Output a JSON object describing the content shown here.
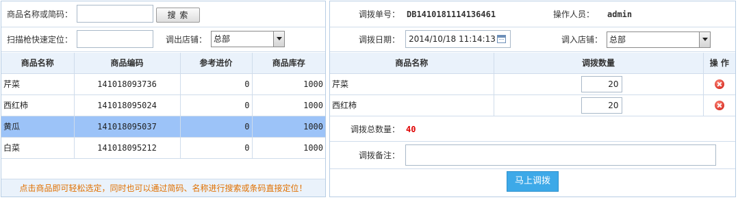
{
  "left": {
    "search_label": "商品名称或简码：",
    "search_value": "",
    "search_button": "搜 索",
    "scan_label": "扫描枪快速定位：",
    "scan_value": "",
    "out_store_label": "调出店铺：",
    "out_store_selected": "总部",
    "columns": [
      "商品名称",
      "商品编码",
      "参考进价",
      "商品库存"
    ],
    "rows": [
      {
        "name": "芹菜",
        "code": "141018093736",
        "price": "0",
        "stock": "1000",
        "selected": false
      },
      {
        "name": "西红柿",
        "code": "141018095024",
        "price": "0",
        "stock": "1000",
        "selected": false
      },
      {
        "name": "黄瓜",
        "code": "141018095037",
        "price": "0",
        "stock": "1000",
        "selected": true
      },
      {
        "name": "白菜",
        "code": "141018095212",
        "price": "0",
        "stock": "1000",
        "selected": false
      }
    ],
    "hint": "点击商品即可轻松选定，同时也可以通过简码、名称进行搜索或条码直接定位！"
  },
  "right": {
    "order_no_label": "调拨单号：",
    "order_no": "DB1410181114136461",
    "operator_label": "操作人员：",
    "operator": "admin",
    "date_label": "调拨日期：",
    "date_value": "2014/10/18 11:14:13",
    "in_store_label": "调入店铺：",
    "in_store_selected": "总部",
    "columns": [
      "商品名称",
      "调拨数量",
      "操 作"
    ],
    "items": [
      {
        "name": "芹菜",
        "qty": "20"
      },
      {
        "name": "西红柿",
        "qty": "20"
      }
    ],
    "total_label": "调拨总数量：",
    "total_value": "40",
    "remark_label": "调拨备注：",
    "remark_value": "",
    "submit_label": "马上调拨"
  },
  "colors": {
    "header_bg": "#eaf2fb",
    "selected_row": "#9cc3f8",
    "hint_text": "#e07000",
    "total_text": "#e00000",
    "primary_button": "#3da9e8"
  }
}
